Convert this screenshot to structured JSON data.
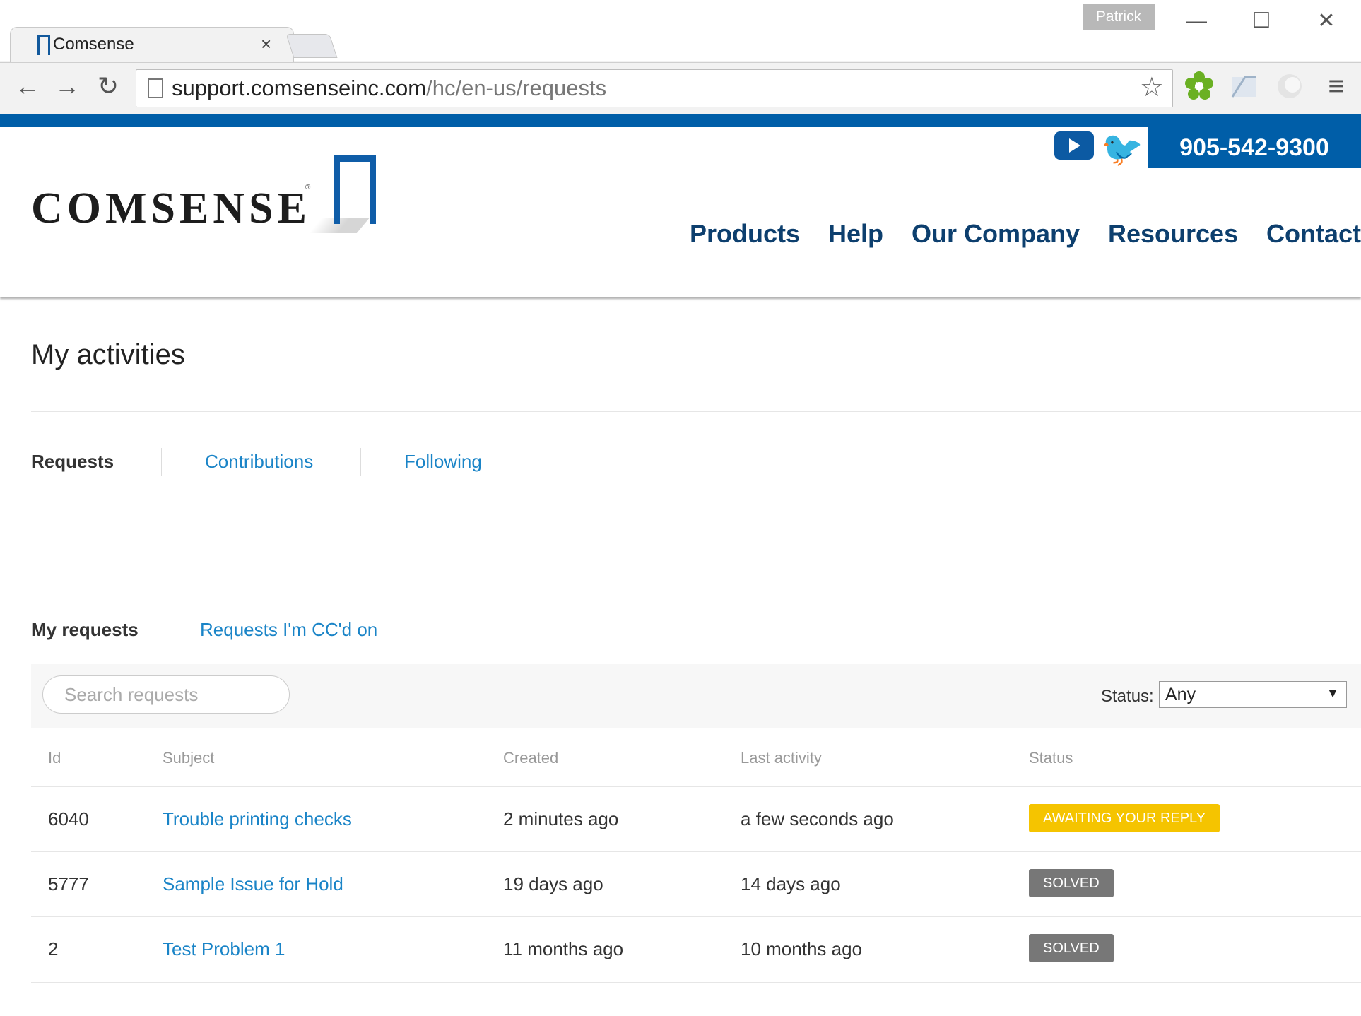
{
  "browser": {
    "tab_title": "Comsense",
    "tab_close": "×",
    "profile_name": "Patrick",
    "url_domain": "support.comsenseinc.com",
    "url_path": "/hc/en-us/requests",
    "window_minimize": "—",
    "window_maximize": "☐",
    "window_close": "✕",
    "back_icon": "←",
    "forward_icon": "→",
    "reload_icon": "↻",
    "bookmark_icon": "☆",
    "menu_icon": "≡"
  },
  "site": {
    "logo_text": "COMSENSE",
    "logo_mark": "®",
    "phone": "905-542-9300",
    "twitter_icon": "🐦",
    "nav": [
      "Products",
      "Help",
      "Our Company",
      "Resources",
      "Contact"
    ],
    "brand_color": "#005ea8"
  },
  "page": {
    "title": "My activities",
    "subnav": {
      "requests": "Requests",
      "contributions": "Contributions",
      "following": "Following"
    },
    "request_tabs": {
      "my_requests": "My requests",
      "cc_requests": "Requests I'm CC'd on"
    },
    "search_placeholder": "Search requests",
    "status_label": "Status:",
    "status_value": "Any",
    "status_caret": "▼",
    "table": {
      "headers": {
        "id": "Id",
        "subject": "Subject",
        "created": "Created",
        "last_activity": "Last activity",
        "status": "Status"
      },
      "rows": [
        {
          "id": "6040",
          "subject": "Trouble printing checks",
          "created": "2 minutes ago",
          "last_activity": "a few seconds ago",
          "status": "AWAITING YOUR REPLY",
          "status_color": "#f5c400"
        },
        {
          "id": "5777",
          "subject": "Sample Issue for Hold",
          "created": "19 days ago",
          "last_activity": "14 days ago",
          "status": "SOLVED",
          "status_color": "#777777"
        },
        {
          "id": "2",
          "subject": "Test Problem 1",
          "created": "11 months ago",
          "last_activity": "10 months ago",
          "status": "SOLVED",
          "status_color": "#777777"
        }
      ]
    }
  }
}
